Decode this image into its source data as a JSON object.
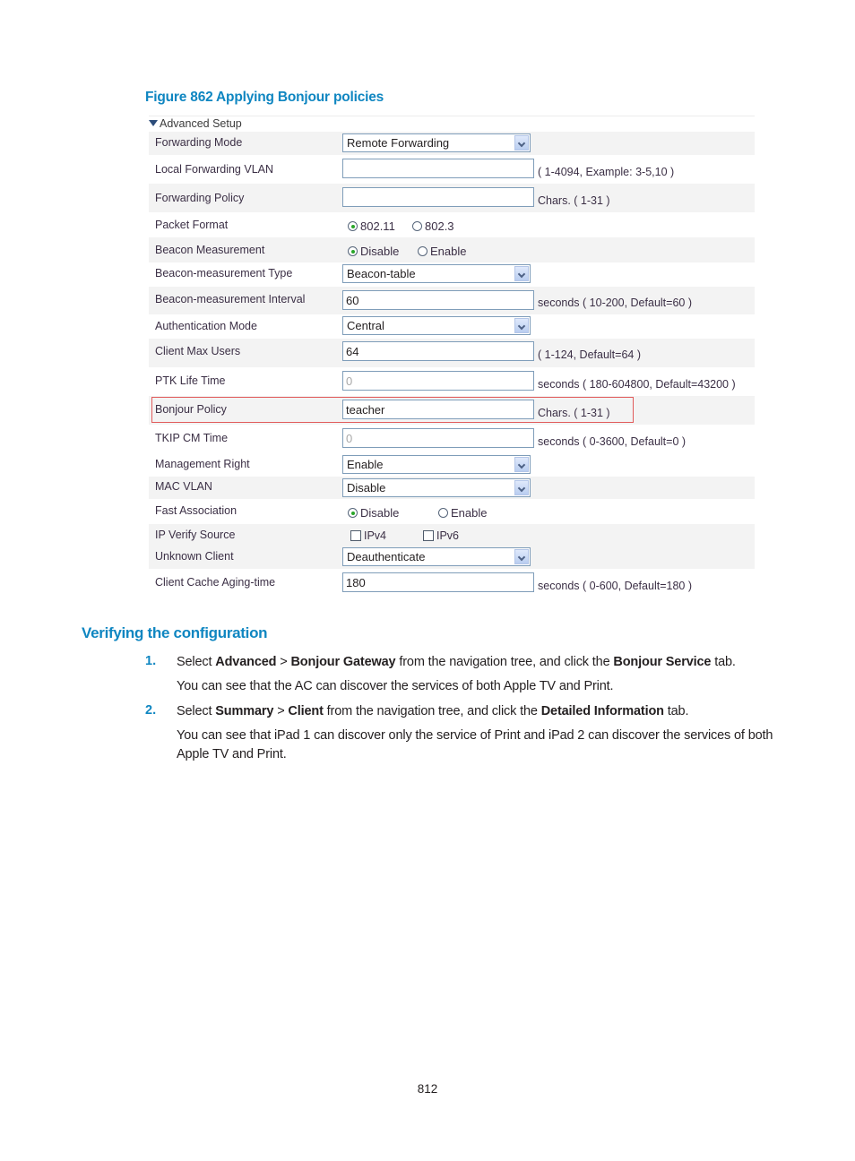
{
  "figure": {
    "title": "Figure 862 Applying Bonjour policies",
    "section_toggle": "Advanced Setup",
    "rows": {
      "forwarding_mode": {
        "label": "Forwarding Mode",
        "value": "Remote Forwarding"
      },
      "local_forwarding_vlan": {
        "label": "Local Forwarding VLAN",
        "value": "",
        "hint": "( 1-4094, Example: 3-5,10 )"
      },
      "forwarding_policy": {
        "label": "Forwarding Policy",
        "value": "",
        "hint": "Chars. ( 1-31 )"
      },
      "packet_format": {
        "label": "Packet Format",
        "options": [
          "802.11",
          "802.3"
        ],
        "selected": "802.11"
      },
      "beacon_measurement": {
        "label": "Beacon Measurement",
        "options": [
          "Disable",
          "Enable"
        ],
        "selected": "Disable"
      },
      "beacon_measurement_type": {
        "label": "Beacon-measurement Type",
        "value": "Beacon-table"
      },
      "beacon_measurement_interval": {
        "label": "Beacon-measurement Interval",
        "value": "60",
        "hint": "seconds ( 10-200, Default=60 )"
      },
      "authentication_mode": {
        "label": "Authentication Mode",
        "value": "Central"
      },
      "client_max_users": {
        "label": "Client Max Users",
        "value": "64",
        "hint": "( 1-124, Default=64 )"
      },
      "ptk_life_time": {
        "label": "PTK Life Time",
        "value": "0",
        "hint": "seconds ( 180-604800, Default=43200 )"
      },
      "bonjour_policy": {
        "label": "Bonjour Policy",
        "value": "teacher",
        "hint": "Chars. ( 1-31 )"
      },
      "tkip_cm_time": {
        "label": "TKIP CM Time",
        "value": "0",
        "hint": "seconds ( 0-3600, Default=0 )"
      },
      "management_right": {
        "label": "Management Right",
        "value": "Enable"
      },
      "mac_vlan": {
        "label": "MAC VLAN",
        "value": "Disable"
      },
      "fast_association": {
        "label": "Fast Association",
        "options": [
          "Disable",
          "Enable"
        ],
        "selected": "Disable"
      },
      "ip_verify_source": {
        "label": "IP Verify Source",
        "options": [
          "IPv4",
          "IPv6"
        ],
        "checked": []
      },
      "unknown_client": {
        "label": "Unknown Client",
        "value": "Deauthenticate"
      },
      "client_cache_aging_time": {
        "label": "Client Cache Aging-time",
        "value": "180",
        "hint": "seconds ( 0-600, Default=180 )"
      }
    },
    "highlight_color": "#e15b5b"
  },
  "section": {
    "heading": "Verifying the configuration",
    "steps": [
      {
        "num": "1.",
        "parts": [
          "Select ",
          "Advanced",
          " > ",
          "Bonjour Gateway",
          " from the navigation tree, and click the ",
          "Bonjour Service",
          " tab."
        ],
        "result": "You can see that the AC can discover the services of both Apple TV and Print."
      },
      {
        "num": "2.",
        "parts": [
          "Select ",
          "Summary",
          " > ",
          "Client",
          " from the navigation tree, and click the ",
          "Detailed Information",
          " tab."
        ],
        "result": "You can see that iPad 1 can discover only the service of Print and iPad 2 can discover the services of both Apple TV and Print."
      }
    ]
  },
  "page_number": "812",
  "colors": {
    "accent": "#0f86c1",
    "row_alt": "#f3f3f3"
  }
}
